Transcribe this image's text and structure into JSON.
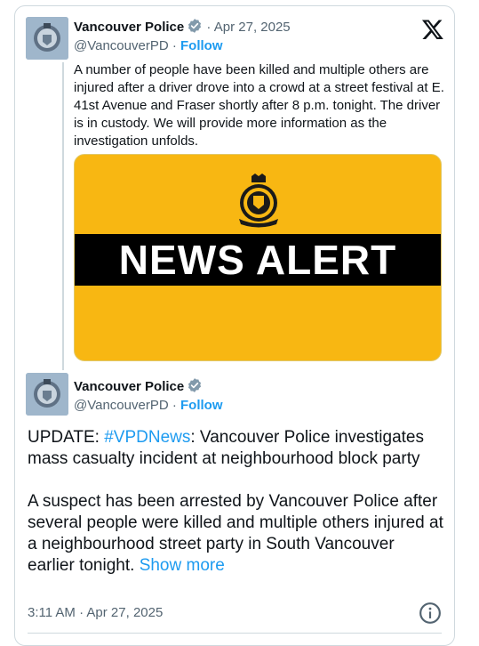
{
  "tweet1": {
    "author_name": "Vancouver Police",
    "separator": " · ",
    "date": "Apr 27, 2025",
    "handle": "@VancouverPD",
    "handle_sep": " · ",
    "follow_label": "Follow",
    "text": "A number of people have been killed and multiple others are injured after a driver drove into a crowd at a street festival at E. 41st Avenue and Fraser shortly after 8 p.m. tonight. The driver is in custody. We will provide more information as the investigation unfolds.",
    "image": {
      "headline": "NEWS ALERT",
      "background_color": "#f8b712",
      "bar_color": "#000000"
    }
  },
  "tweet2": {
    "author_name": "Vancouver Police",
    "handle": "@VancouverPD",
    "handle_sep": " · ",
    "follow_label": "Follow",
    "para1_prefix": "UPDATE: ",
    "para1_hashtag": "#VPDNews",
    "para1_rest": ": Vancouver Police investigates mass casualty incident at neighbourhood block party",
    "para2": "A suspect has been arrested by Vancouver Police after several people were killed and multiple others injured at a neighbourhood street party in South Vancouver earlier tonight.",
    "show_more_label": "Show more",
    "timestamp": "3:11 AM · Apr 27, 2025"
  },
  "icons": {
    "platform_logo": "x-logo-icon",
    "verified": "verified-badge-icon",
    "info": "info-icon"
  },
  "colors": {
    "link": "#1d9bf0",
    "verified_badge": "#829aab",
    "secondary_text": "#536471"
  }
}
